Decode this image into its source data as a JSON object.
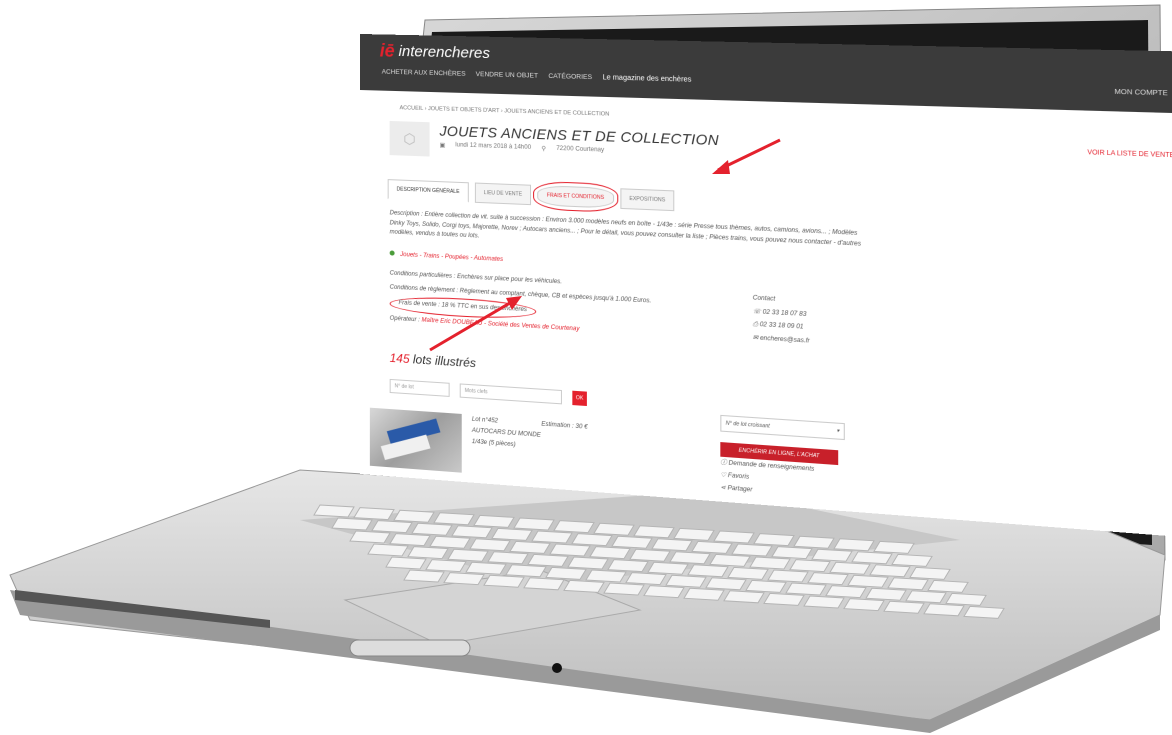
{
  "header": {
    "logo_text": "interencheres",
    "nav": [
      "ACHETER AUX ENCHÈRES",
      "VENDRE UN OBJET",
      "CATÉGORIES"
    ],
    "magazine": "Le magazine des enchères",
    "account": "MON COMPTE"
  },
  "breadcrumb": "ACCUEIL › Jouets et objets d'art › JOUETS ANCIENS ET DE COLLECTION",
  "sale": {
    "title": "JOUETS ANCIENS ET DE COLLECTION",
    "date": "lundi 12 mars 2018 à 14h00",
    "location": "72200 Courtenay",
    "view_catalogue": "VOIR LA LISTE DE VENTE"
  },
  "tabs": [
    "DESCRIPTION GÉNÉRALE",
    "LIEU DE VENTE",
    "FRAIS ET CONDITIONS",
    "EXPOSITIONS"
  ],
  "description": "Description : Entière collection de vit. suite à succession : Environ 3.000 modèles neufs en boîte - 1/43e : série Presse tous thèmes, autos, camions, avions... ; Modèles Dinky Toys, Solido, Corgi toys, Majorette, Norev ; Autocars anciens... ; Pour le détail, vous pouvez consulter la liste ; Pièces trains, vous pouvez nous contacter - d'autres modèles, vendus à toutes ou lots.",
  "categories": "Jouets - Trains - Poupées - Automates",
  "conditions_line": "Conditions particulières : Enchères sur place pour les véhicules.",
  "payment": "Conditions de règlement : Règlement au comptant, chèque, CB et espèces jusqu'à 1.000 Euros.",
  "fees": "Frais de vente : 18 % TTC en sus des enchères",
  "operator_label": "Opérateur : ",
  "operator": "Maître Eric DOUBEAU - Société des Ventes de Courtenay",
  "contact": {
    "title": "Contact",
    "phone": "02 33 18 07 83",
    "fax": "02 33 18 09 01",
    "email": "encheres@sas.fr"
  },
  "lots": {
    "count": "145",
    "label": "lots illustrés",
    "search_lot_placeholder": "N° de lot",
    "search_text_placeholder": "Mots clefs",
    "ok": "OK",
    "sort": "N° de lot croissant",
    "lot_number": "Lot n°452",
    "lot_title": "AUTOCARS DU MONDE 1/43e (5 pièces)",
    "estimate": "Estimation : 30 €",
    "bid_button": "ENCHÉRIR EN LIGNE, L'ACHAT",
    "info_request": "Demande de renseignements",
    "favorite": "Favoris",
    "share": "Partager"
  },
  "colors": {
    "brand_red": "#e4212d",
    "header_bg": "#3b3b3b"
  }
}
